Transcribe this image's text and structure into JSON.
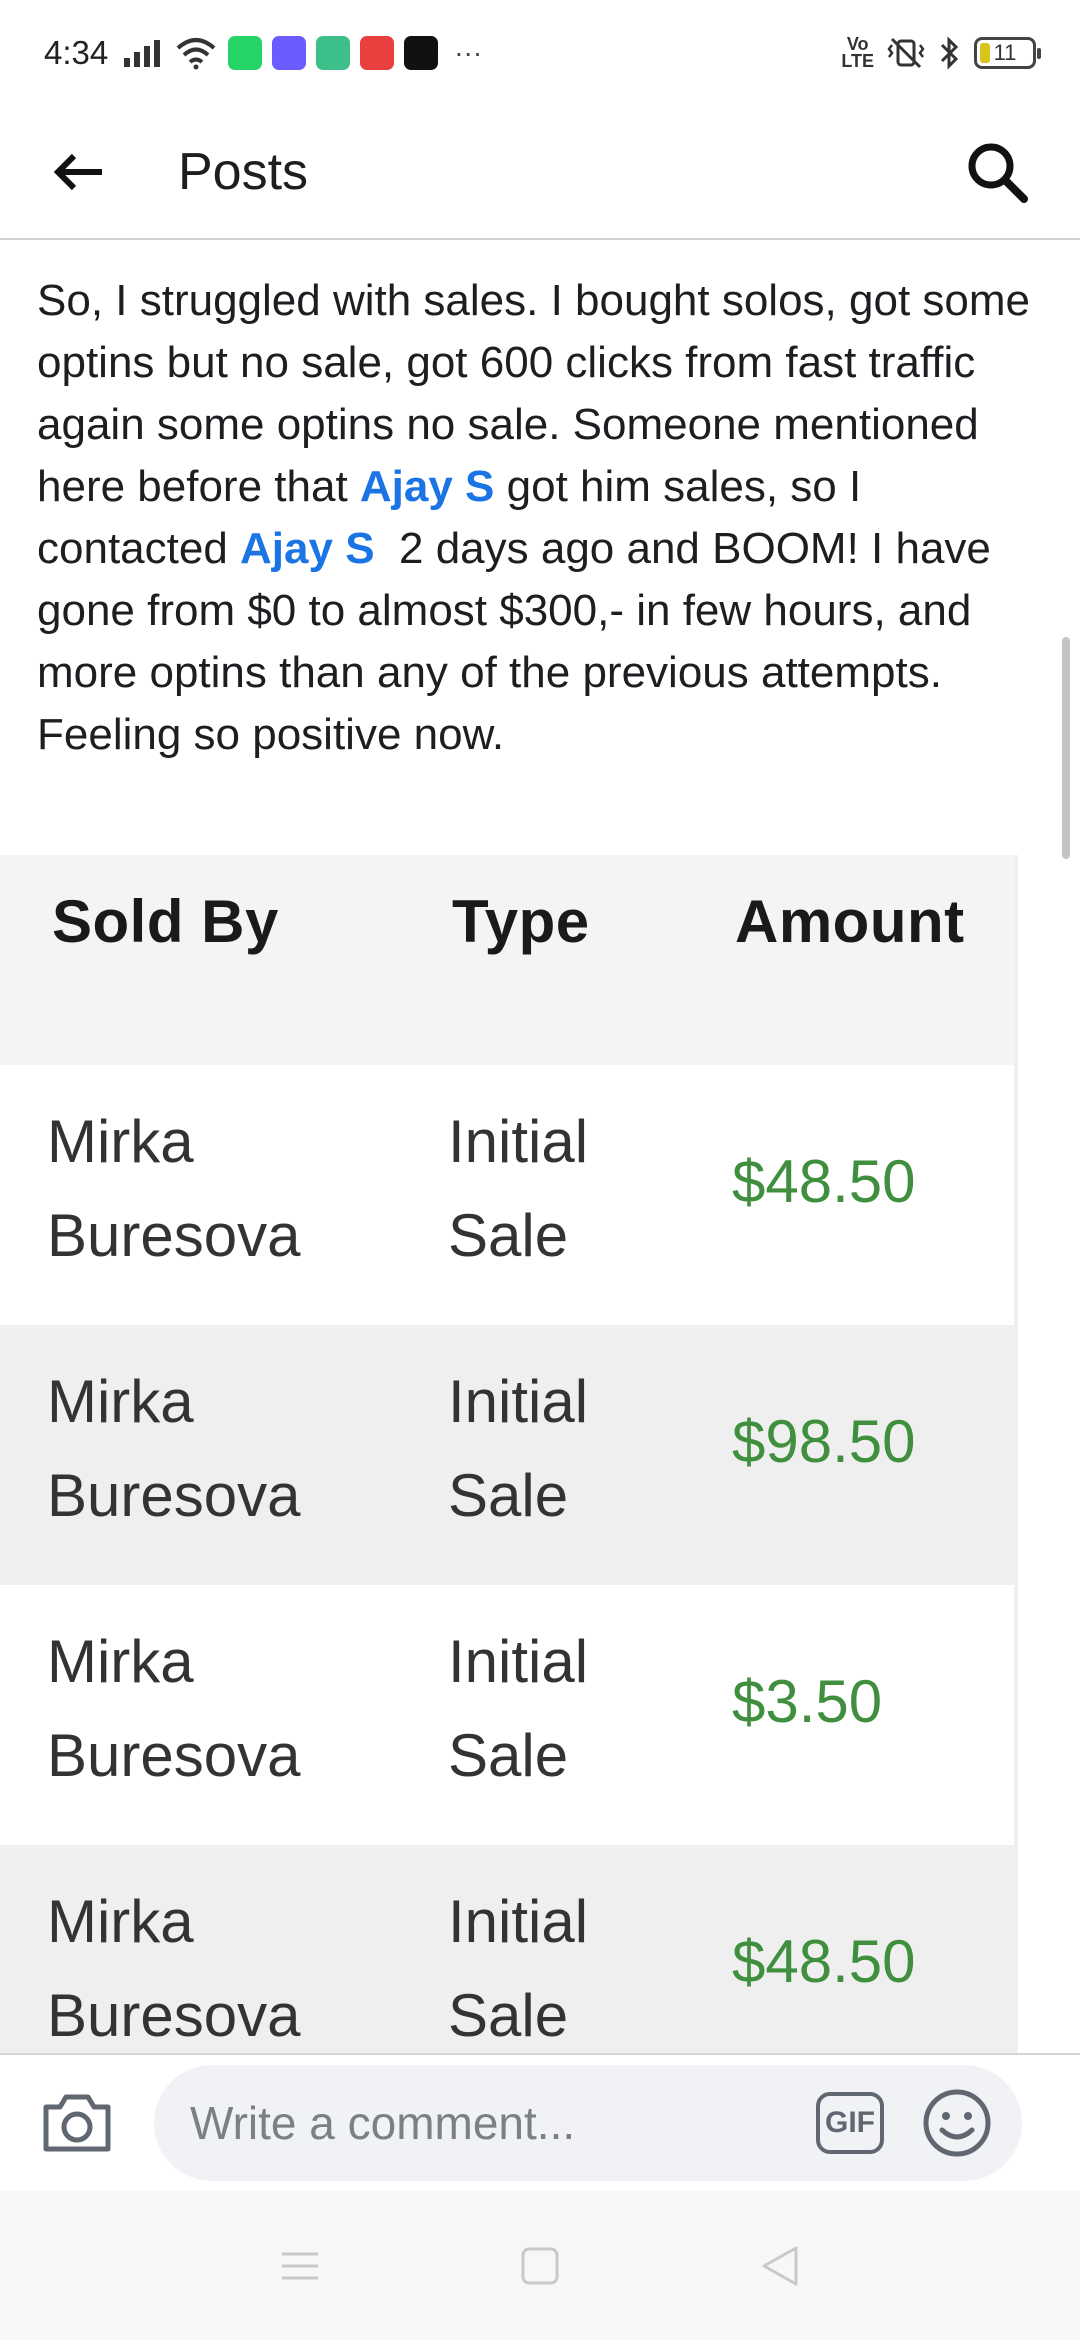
{
  "status_bar": {
    "time": "4:34",
    "more_indicator": "···",
    "volte": "Vo\nLTE",
    "battery": "11"
  },
  "header": {
    "title": "Posts",
    "back_icon": "back-arrow-icon",
    "search_icon": "search-icon"
  },
  "post": {
    "text_parts": [
      "So, I struggled with sales. I bought solos, got some optins but no sale, got 600 clicks from fast traffic again some optins no sale. Someone mentioned here before that ",
      "Ajay S",
      " got him sales, so I contacted ",
      "Ajay S",
      "  2 days ago and BOOM! I have gone from $0 to almost $300,- in few hours, and more optins than any of the previous attempts. Feeling so positive now."
    ]
  },
  "sales_table": {
    "headers": [
      "Sold By",
      "Type",
      "Amount"
    ],
    "rows": [
      {
        "sold_by": [
          "Mirka",
          "Buresova"
        ],
        "type": [
          "Initial",
          "Sale"
        ],
        "amount": "$48.50"
      },
      {
        "sold_by": [
          "Mirka",
          "Buresova"
        ],
        "type": [
          "Initial",
          "Sale"
        ],
        "amount": "$98.50"
      },
      {
        "sold_by": [
          "Mirka",
          "Buresova"
        ],
        "type": [
          "Initial",
          "Sale"
        ],
        "amount": "$3.50"
      },
      {
        "sold_by": [
          "Mirka",
          "Buresova"
        ],
        "type": [
          "Initial",
          "Sale"
        ],
        "amount": "$48.50"
      }
    ]
  },
  "comment_bar": {
    "placeholder": "Write a comment...",
    "gif_label": "GIF"
  },
  "colors": {
    "mention": "#1b74e4",
    "amount_green": "#3f8f3f"
  }
}
